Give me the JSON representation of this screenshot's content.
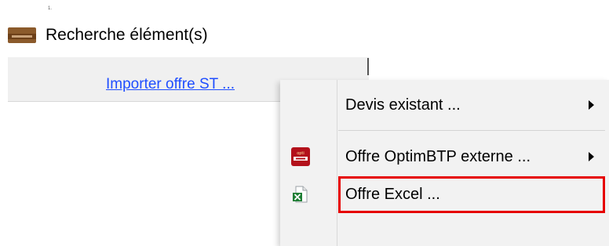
{
  "page_marker": "1.",
  "search": {
    "label": "Recherche élément(s)",
    "icon": "optimbtp-app-icon"
  },
  "import_panel": {
    "link_label": "Importer offre ST ..."
  },
  "context_menu": {
    "items": [
      {
        "label": "Devis existant ...",
        "icon": null,
        "has_submenu": true
      },
      {
        "label": "Offre OptimBTP externe ...",
        "icon": "optimbtp-icon",
        "has_submenu": true
      },
      {
        "label": "Offre Excel ...",
        "icon": "excel-file-icon",
        "has_submenu": false,
        "highlighted": true
      }
    ]
  },
  "colors": {
    "link": "#1f4eff",
    "highlight_frame": "#e60000",
    "menu_background": "#f2f2f2"
  }
}
